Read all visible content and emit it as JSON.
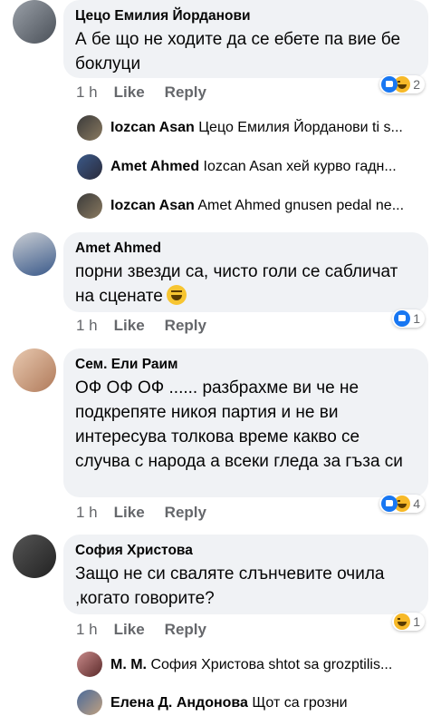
{
  "comments": [
    {
      "author": "Цецо Емилия Йорданови",
      "text": "А бе що не ходите да се ебете па вие бе боклуци",
      "time": "1 h",
      "like": "Like",
      "reply": "Reply",
      "reaction_count": "2",
      "reactions": [
        "like-icon",
        "haha-icon"
      ]
    },
    {
      "author": "Amet Ahmed",
      "text": "порни звезди са,  чисто голи се сабличат на сценате",
      "time": "1 h",
      "like": "Like",
      "reply": "Reply",
      "reaction_count": "1",
      "reactions": [
        "like-icon"
      ]
    },
    {
      "author": "Сем. Ели  Раим",
      "text": "ОФ ОФ ОФ ...... разбрахме ви че не подкрепяте никоя партия и не ви интересува толкова време какво се случва с народа а всеки гледа за гъза си",
      "time": "1 h",
      "like": "Like",
      "reply": "Reply",
      "reaction_count": "4",
      "reactions": [
        "like-icon",
        "haha-icon"
      ]
    },
    {
      "author": "София Христова",
      "text": "Защо не си сваляте слънчевите очила ,когато говорите?",
      "time": "1 h",
      "like": "Like",
      "reply": "Reply",
      "reaction_count": "1",
      "reactions": [
        "haha-icon"
      ]
    }
  ],
  "replies": [
    {
      "author": "Iozcan Asan",
      "text": "Цецо Емилия Йорданови ti s..."
    },
    {
      "author": "Amet Ahmed",
      "text": "Iozcan Asan  хей курво гадн..."
    },
    {
      "author": "Iozcan Asan",
      "text": "Amet Ahmed gnusen pedal ne..."
    },
    {
      "author": "М. М.",
      "text": "София Христова  shtot sa grozptilis..."
    },
    {
      "author": "Елена Д. Андонова",
      "text": "Щот са грозни"
    }
  ]
}
